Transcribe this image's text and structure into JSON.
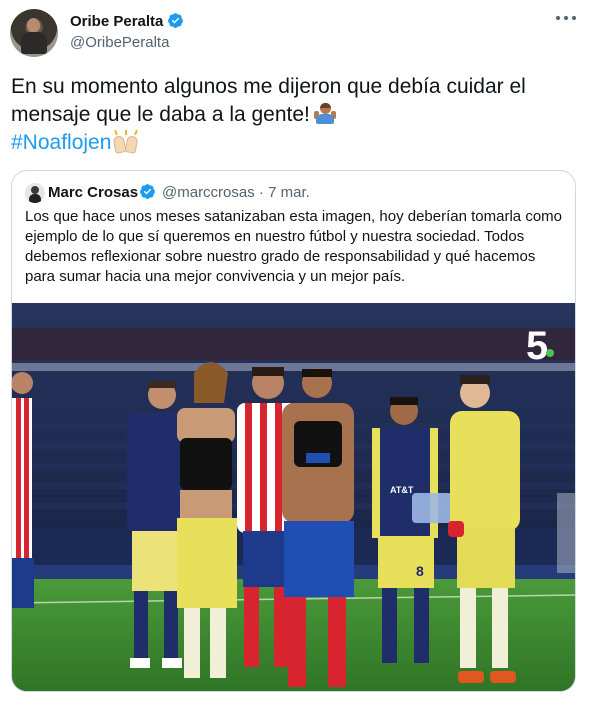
{
  "tweet": {
    "author_name": "Oribe Peralta",
    "author_handle": "@OribePeralta",
    "text_line1": "En su momento algunos me dijeron  que debía cuidar el",
    "text_line2": "mensaje que le daba a la gente!",
    "hashtag": "#Noaflojen",
    "emojis": [
      "man-shrugging-emoji",
      "raising-hands-emoji"
    ]
  },
  "quoted_tweet": {
    "author_name": "Marc Crosas",
    "author_handle": "@marccrosas",
    "separator": "·",
    "date": "7 mar.",
    "lines": [
      "Los que hace unos meses satanizaban esta imagen, hoy deberían tomarla como",
      "ejemplo de lo que sí queremos en nuestro fútbol y nuestra sociedad. Todos",
      "debemos reflexionar sobre nuestro grado de responsabilidad y qué hacemos",
      "para sumar hacia una mejor convivencia y un mejor país."
    ],
    "photo": {
      "broadcast_logo": "5",
      "jersey_number": "8",
      "shirt_sponsor": "AT&T"
    }
  },
  "colors": {
    "link": "#1d9bf0",
    "verified": "#1d9bf0",
    "secondary_text": "#536471",
    "border": "#cfd9de",
    "america_yellow": "#e8df5a",
    "america_navy": "#1f2d6b",
    "chivas_red": "#d8242f",
    "pitch_green": "#3f8a32"
  },
  "icons": {
    "verified": "verified-badge-icon",
    "more": "more-dots-icon"
  }
}
